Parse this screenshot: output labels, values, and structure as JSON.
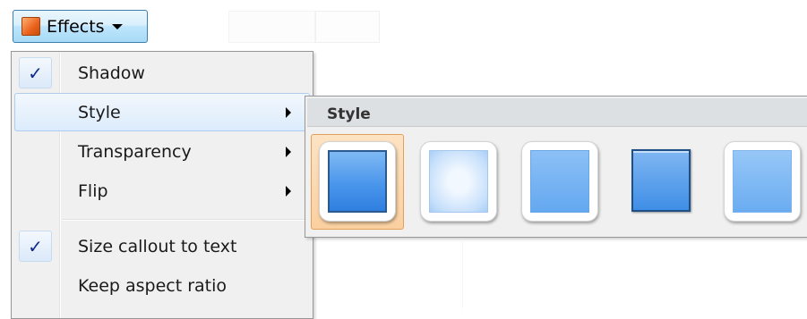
{
  "toolbar": {
    "effects_label": "Effects"
  },
  "menu": {
    "items": [
      {
        "label": "Shadow",
        "checked": true,
        "submenu": false
      },
      {
        "label": "Style",
        "checked": false,
        "submenu": true,
        "highlighted": true
      },
      {
        "label": "Transparency",
        "checked": false,
        "submenu": true
      },
      {
        "label": "Flip",
        "checked": false,
        "submenu": true
      },
      {
        "label": "Size callout to text",
        "checked": true,
        "submenu": false
      },
      {
        "label": "Keep aspect ratio",
        "checked": false,
        "submenu": false
      }
    ],
    "check_glyph": "✓"
  },
  "submenu": {
    "title": "Style",
    "tiles": [
      {
        "icon": "style-bevel-dark-border",
        "selected": true
      },
      {
        "icon": "style-soft-glow",
        "selected": false
      },
      {
        "icon": "style-flat",
        "selected": false
      },
      {
        "icon": "style-raised-bevel",
        "selected": false
      },
      {
        "icon": "style-flat-light",
        "selected": false
      }
    ]
  },
  "colors": {
    "highlight_border": "#aeccf0",
    "selected_tile": "#fbd0a0",
    "menu_background": "#f0f0f0"
  }
}
